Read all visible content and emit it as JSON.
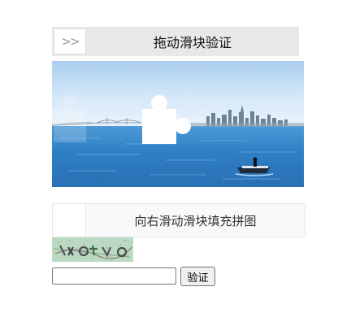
{
  "top_slider": {
    "handle_icon": "double-chevron-right-icon",
    "handle_glyph": ">>",
    "label": "拖动滑块验证"
  },
  "puzzle": {
    "image_description_icon": "harbor-cityscape-image",
    "piece_icon": "puzzle-piece-icon"
  },
  "bottom_slider": {
    "label": "向右滑动滑块填充拼图"
  },
  "captcha": {
    "image_icon": "captcha-image",
    "input_value": "",
    "input_placeholder": "",
    "button_label": "验证"
  },
  "colors": {
    "top_slider_bg": "#e8e8e8",
    "bottom_slider_bg": "#f7f9fa",
    "sky_top": "#bcd7f2",
    "water": "#2f83cc"
  }
}
